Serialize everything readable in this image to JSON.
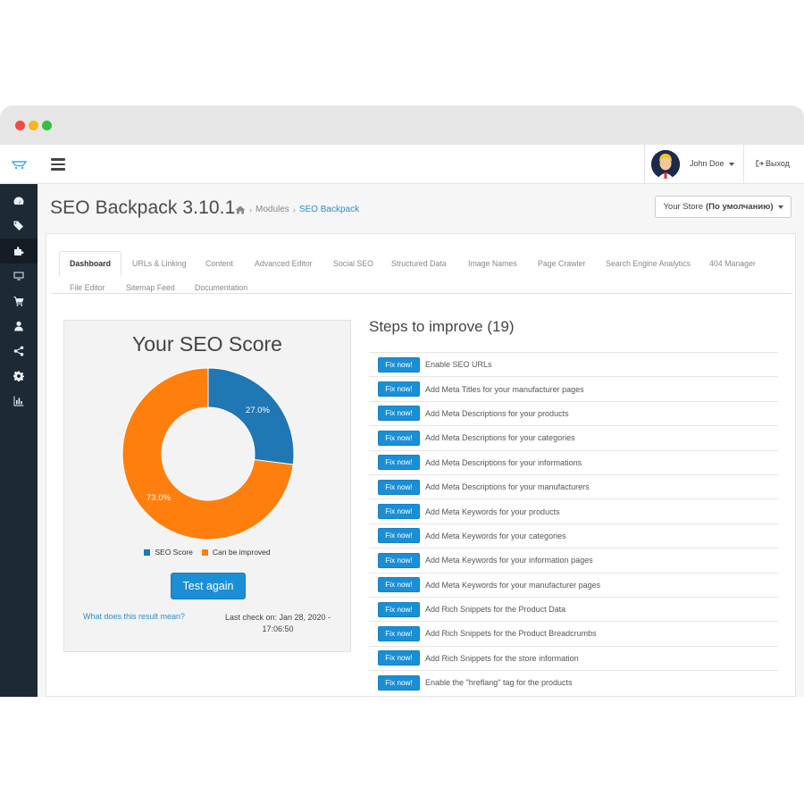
{
  "header": {
    "user_name": "John Doe",
    "logout_label": "Выход"
  },
  "sidebar": {
    "items": [
      {
        "icon": "dashboard-icon",
        "active": false
      },
      {
        "icon": "tags-icon",
        "active": false
      },
      {
        "icon": "puzzle-icon",
        "active": true
      },
      {
        "icon": "monitor-icon",
        "active": false
      },
      {
        "icon": "cart-icon",
        "active": false
      },
      {
        "icon": "user-icon",
        "active": false
      },
      {
        "icon": "share-icon",
        "active": false
      },
      {
        "icon": "gear-icon",
        "active": false
      },
      {
        "icon": "bar-chart-icon",
        "active": false
      }
    ]
  },
  "page": {
    "title": "SEO Backpack 3.10.1",
    "breadcrumb": [
      "Modules",
      "SEO Backpack"
    ],
    "store_selector": {
      "label": "Your Store",
      "value": "(По умолчанию)"
    }
  },
  "tabs": {
    "active": "Dashboard",
    "items": [
      "Dashboard",
      "URLs & Linking",
      "Content",
      "Advanced Editor",
      "Social SEO",
      "Structured Data",
      "Image Names",
      "Page Crawler",
      "Search Engine Analytics",
      "404 Manager",
      "File Editor",
      "Sitemap Feed",
      "Documentation"
    ]
  },
  "score": {
    "title": "Your SEO Score",
    "test_button": "Test again",
    "meaning_link": "What does this result mean?",
    "last_check": "Last check on: Jan 28, 2020 - 17:06:50"
  },
  "chart_data": {
    "type": "pie",
    "categories": [
      "SEO Score",
      "Can be improved"
    ],
    "values": [
      27.0,
      73.0
    ],
    "labels": [
      "27.0%",
      "73.0%"
    ],
    "colors": [
      "#1f77b4",
      "#ff7f0e"
    ],
    "legend_position": "bottom"
  },
  "steps": {
    "title": "Steps to improve (19)",
    "fix_label": "Fix now!",
    "items": [
      "Enable SEO URLs",
      "Add Meta Titles for your manufacturer pages",
      "Add Meta Descriptions for your products",
      "Add Meta Descriptions for your categories",
      "Add Meta Descriptions for your informations",
      "Add Meta Descriptions for your manufacturers",
      "Add Meta Keywords for your products",
      "Add Meta Keywords for your categories",
      "Add Meta Keywords for your information pages",
      "Add Meta Keywords for your manufacturer pages",
      "Add Rich Snippets for the Product Data",
      "Add Rich Snippets for the Product Breadcrumbs",
      "Add Rich Snippets for the store information",
      "Enable the \"hreflang\" tag for the products"
    ]
  }
}
